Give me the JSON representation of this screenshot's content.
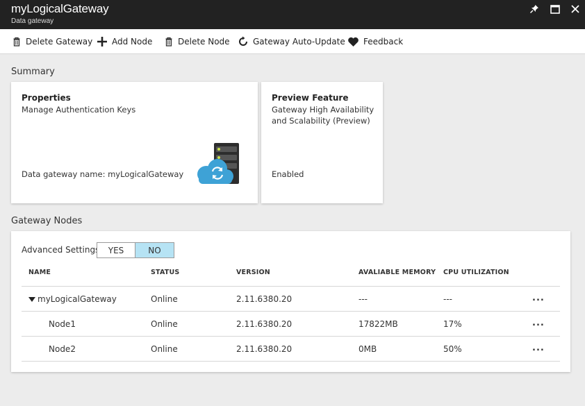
{
  "titlebar": {
    "title": "myLogicalGateway",
    "subtitle": "Data gateway",
    "controls": [
      "pin-icon",
      "maximize-icon",
      "close-icon"
    ]
  },
  "toolbar": {
    "items": [
      {
        "label": "Delete Gateway",
        "icon": "trash-icon"
      },
      {
        "label": "Add Node",
        "icon": "plus-icon"
      },
      {
        "label": "Delete Node",
        "icon": "trash-icon"
      },
      {
        "label": "Gateway Auto-Update",
        "icon": "refresh-icon"
      },
      {
        "label": "Feedback",
        "icon": "heart-icon"
      }
    ]
  },
  "summary": {
    "title": "Summary",
    "properties_card": {
      "title": "Properties",
      "line1": "Manage Authentication Keys",
      "name_line": "Data gateway name: myLogicalGateway",
      "icon": "gateway-server-icon"
    },
    "preview_card": {
      "title": "Preview Feature",
      "line1": "Gateway High Availability",
      "line2": "and Scalability (Preview)",
      "status": "Enabled"
    }
  },
  "gateway_nodes": {
    "title": "Gateway Nodes",
    "advanced_label": "Advanced Settings",
    "toggle": {
      "yes": "YES",
      "no": "NO",
      "selected": "NO"
    },
    "columns": [
      "NAME",
      "STATUS",
      "VERSION",
      "AVALIABLE MEMORY",
      "CPU UTILIZATION"
    ],
    "rows": [
      {
        "name": "myLogicalGateway",
        "status": "Online",
        "version": "2.11.6380.20",
        "memory": "---",
        "cpu": "---",
        "more": "...",
        "expanded": true
      },
      {
        "name": "Node1",
        "status": "Online",
        "version": "2.11.6380.20",
        "memory": "17822MB",
        "cpu": "17%",
        "more": "..."
      },
      {
        "name": "Node2",
        "status": "Online",
        "version": "2.11.6380.20",
        "memory": "0MB",
        "cpu": "50%",
        "more": "..."
      }
    ]
  },
  "colors": {
    "titlebar_bg": "#222222",
    "toggle_selected": "#b6e3f4",
    "cloud_blue": "#3ea2d6"
  }
}
